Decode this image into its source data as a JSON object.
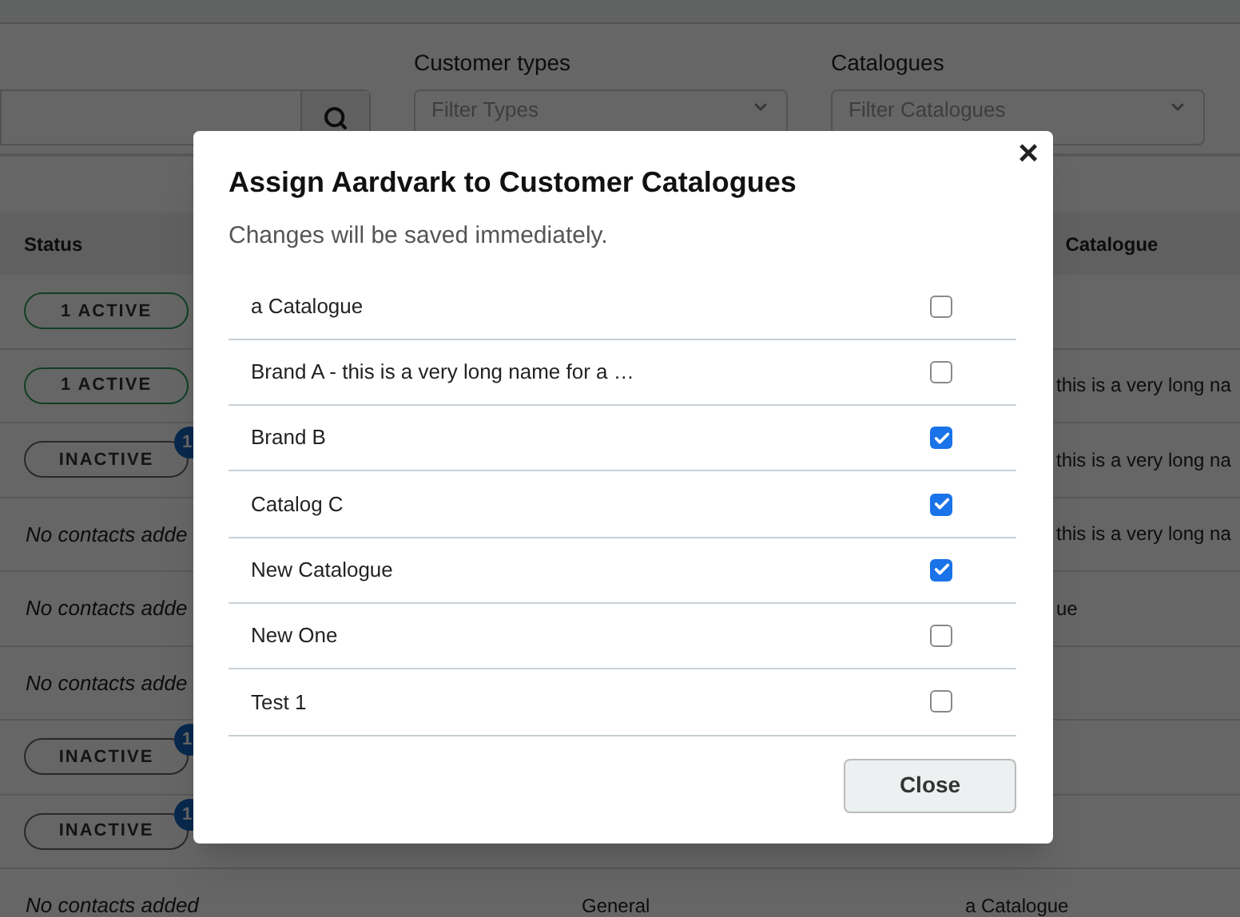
{
  "filters": [
    {
      "label": "Customer types",
      "placeholder": "Filter Types"
    },
    {
      "label": "Catalogues",
      "placeholder": "Filter Catalogues"
    }
  ],
  "table": {
    "columns": [
      "Status",
      "Catalogue"
    ],
    "rows": [
      {
        "status": {
          "kind": "pill",
          "text": "1 ACTIVE",
          "active": true
        }
      },
      {
        "status": {
          "kind": "pill",
          "text": "1 ACTIVE",
          "active": true
        },
        "catalogue": "this is a very long na"
      },
      {
        "status": {
          "kind": "pill",
          "text": "INACTIVE",
          "active": false,
          "badge": "1"
        },
        "catalogue": "this is a very long na"
      },
      {
        "status": {
          "kind": "note",
          "text": "No contacts adde"
        },
        "catalogue": "this is a very long na"
      },
      {
        "status": {
          "kind": "note",
          "text": "No contacts adde"
        },
        "catalogue": "ue"
      },
      {
        "status": {
          "kind": "note",
          "text": "No contacts adde"
        }
      },
      {
        "status": {
          "kind": "pill",
          "text": "INACTIVE",
          "active": false,
          "badge": "1"
        }
      },
      {
        "status": {
          "kind": "pill",
          "text": "INACTIVE",
          "active": false,
          "badge": "1"
        }
      },
      {
        "status": {
          "kind": "note",
          "text": "No contacts added"
        },
        "type": "General",
        "catalogue_full": "a Catalogue"
      }
    ]
  },
  "dialog": {
    "title": "Assign Aardvark to Customer Catalogues",
    "subtitle": "Changes will be saved immediately.",
    "close_icon": "×",
    "items": [
      {
        "name": "a Catalogue",
        "checked": false
      },
      {
        "name": "Brand A - this is a very long name for a …",
        "checked": false
      },
      {
        "name": "Brand B",
        "checked": true
      },
      {
        "name": "Catalog C",
        "checked": true
      },
      {
        "name": "New Catalogue",
        "checked": true
      },
      {
        "name": "New One",
        "checked": false
      },
      {
        "name": "Test 1",
        "checked": false
      }
    ],
    "button": "Close"
  }
}
